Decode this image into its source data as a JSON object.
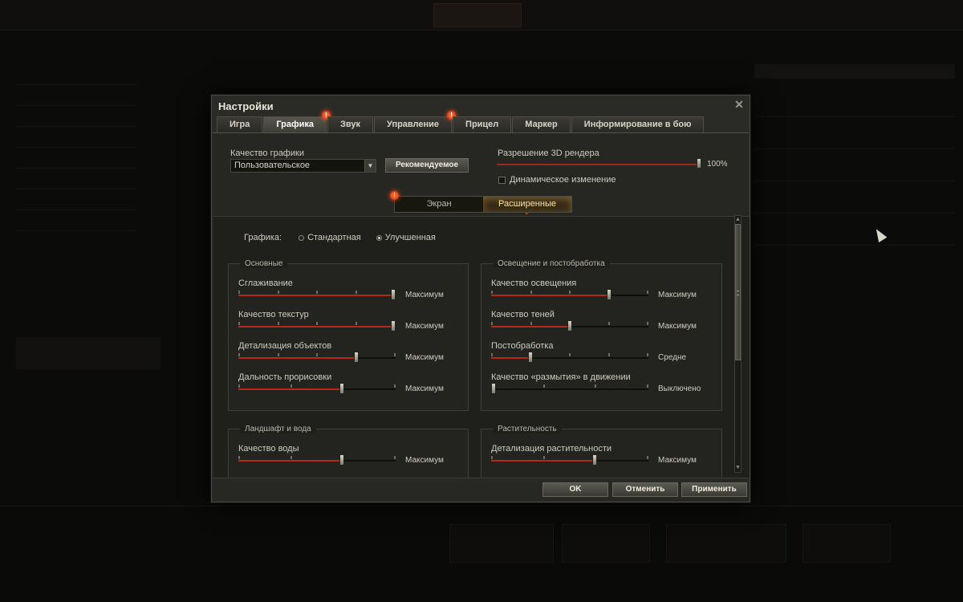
{
  "window": {
    "title": "Настройки",
    "tabs": [
      {
        "label": "Игра",
        "active": false,
        "badge": ""
      },
      {
        "label": "Графика",
        "active": true,
        "badge": "!"
      },
      {
        "label": "Звук",
        "active": false,
        "badge": ""
      },
      {
        "label": "Управление",
        "active": false,
        "badge": "!"
      },
      {
        "label": "Прицел",
        "active": false,
        "badge": ""
      },
      {
        "label": "Маркер",
        "active": false,
        "badge": ""
      },
      {
        "label": "Информирование в бою",
        "active": false,
        "badge": ""
      }
    ]
  },
  "quality": {
    "label": "Качество графики",
    "value": "Пользовательское",
    "recommended_button": "Рекомендуемое"
  },
  "render": {
    "label": "Разрешение 3D рендера",
    "value": "100%",
    "dynamic_label": "Динамическое изменение",
    "dynamic_checked": false
  },
  "subtabs": [
    {
      "label": "Экран",
      "active": false,
      "badge": "!"
    },
    {
      "label": "Расширенные",
      "active": true,
      "badge": ""
    }
  ],
  "graphics_mode": {
    "label": "Графика:",
    "options": [
      {
        "label": "Стандартная",
        "selected": false
      },
      {
        "label": "Улучшенная",
        "selected": true
      }
    ]
  },
  "groups": {
    "basic": {
      "title": "Основные",
      "settings": [
        {
          "name": "Сглаживание",
          "value": "Максимум",
          "level": 1.0,
          "ticks": 5
        },
        {
          "name": "Качество текстур",
          "value": "Максимум",
          "level": 1.0,
          "ticks": 5
        },
        {
          "name": "Детализация объектов",
          "value": "Максимум",
          "level": 0.75,
          "ticks": 5
        },
        {
          "name": "Дальность прорисовки",
          "value": "Максимум",
          "level": 0.66,
          "ticks": 4
        }
      ]
    },
    "lighting": {
      "title": "Освещение и постобработка",
      "settings": [
        {
          "name": "Качество освещения",
          "value": "Максимум",
          "level": 0.75,
          "ticks": 5
        },
        {
          "name": "Качество теней",
          "value": "Максимум",
          "level": 0.5,
          "ticks": 5
        },
        {
          "name": "Постобработка",
          "value": "Средне",
          "level": 0.25,
          "ticks": 5
        },
        {
          "name": "Качество «размытия» в движении",
          "value": "Выключено",
          "level": 0.0,
          "ticks": 4
        }
      ]
    },
    "landscape": {
      "title": "Ландшафт и вода",
      "settings": [
        {
          "name": "Качество воды",
          "value": "Максимум",
          "level": 0.66,
          "ticks": 4
        }
      ]
    },
    "vegetation": {
      "title": "Растительность",
      "settings": [
        {
          "name": "Детализация растительности",
          "value": "Максимум",
          "level": 0.66,
          "ticks": 4
        }
      ]
    }
  },
  "footer": {
    "ok": "OK",
    "cancel": "Отменить",
    "apply": "Применить"
  },
  "colors": {
    "accent_red": "#b32a1a",
    "badge": "#e0401a",
    "active_subtab_text": "#ffe59a"
  }
}
